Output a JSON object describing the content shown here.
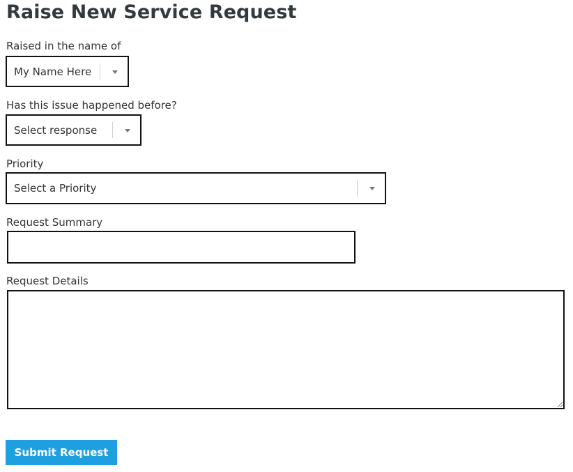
{
  "page": {
    "title": "Raise New Service Request"
  },
  "form": {
    "raised_in_name_of": {
      "label": "Raised in the name of",
      "value": "My Name Here"
    },
    "happened_before": {
      "label": "Has this issue happened before?",
      "value": "Select response"
    },
    "priority": {
      "label": "Priority",
      "value": "Select a Priority"
    },
    "summary": {
      "label": "Request Summary",
      "value": ""
    },
    "details": {
      "label": "Request Details",
      "value": ""
    },
    "submit_label": "Submit Request"
  },
  "theme": {
    "accent": "#1ea0e0",
    "border": "#111111"
  }
}
